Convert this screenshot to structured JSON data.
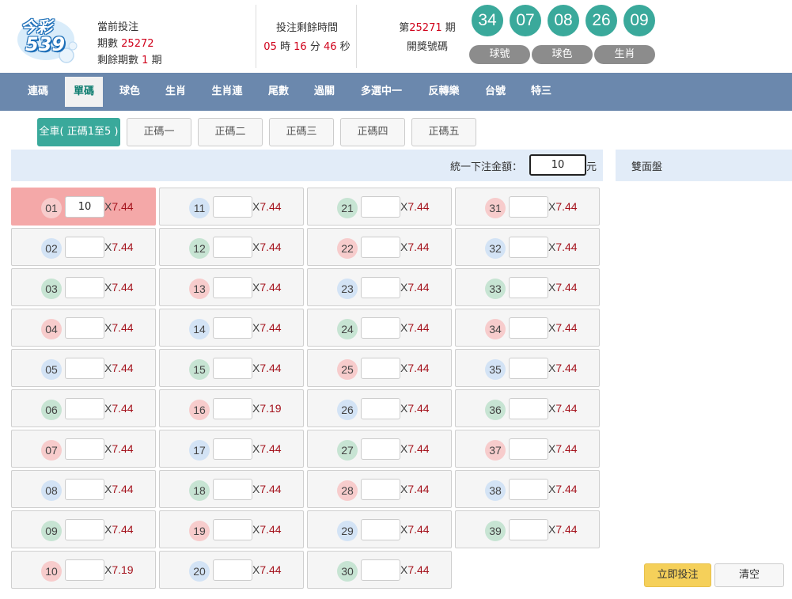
{
  "header": {
    "logo": {
      "line1": "今彩",
      "line2": "539"
    },
    "current_bet_label": "當前投注",
    "period_label": "期數",
    "period_value": "25272",
    "remaining_label": "剩餘期數",
    "remaining_value": "1",
    "remaining_unit": "期",
    "timer_title": "投注剩餘時間",
    "timer": {
      "hours": "05",
      "h_unit": "時",
      "minutes": "16",
      "m_unit": "分",
      "seconds": "46",
      "s_unit": "秒"
    },
    "draw_prefix": "第",
    "draw_period": "25271",
    "draw_suffix": "期",
    "draw_label": "開獎號碼",
    "draw_numbers": [
      "34",
      "07",
      "08",
      "26",
      "09"
    ],
    "view_buttons": [
      "球號",
      "球色",
      "生肖"
    ]
  },
  "nav": {
    "items": [
      "連碼",
      "單碼",
      "球色",
      "生肖",
      "生肖連",
      "尾數",
      "過關",
      "多選中一",
      "反轉樂",
      "台號",
      "特三"
    ],
    "active_index": 1
  },
  "subtabs": {
    "items": [
      "全車( 正碼1至5 )",
      "正碼一",
      "正碼二",
      "正碼三",
      "正碼四",
      "正碼五"
    ],
    "active_index": 0
  },
  "unified": {
    "label": "統一下注金額：",
    "value": "10",
    "unit": "元"
  },
  "side_panel": {
    "label": "雙面盤"
  },
  "grid": {
    "multiply": "X",
    "cells": [
      {
        "num": "01",
        "odds": "7.44",
        "amount": "10",
        "color": "red",
        "selected": true
      },
      {
        "num": "02",
        "odds": "7.44",
        "amount": "",
        "color": "blue"
      },
      {
        "num": "03",
        "odds": "7.44",
        "amount": "",
        "color": "green"
      },
      {
        "num": "04",
        "odds": "7.44",
        "amount": "",
        "color": "red"
      },
      {
        "num": "05",
        "odds": "7.44",
        "amount": "",
        "color": "blue"
      },
      {
        "num": "06",
        "odds": "7.44",
        "amount": "",
        "color": "green"
      },
      {
        "num": "07",
        "odds": "7.44",
        "amount": "",
        "color": "red"
      },
      {
        "num": "08",
        "odds": "7.44",
        "amount": "",
        "color": "blue"
      },
      {
        "num": "09",
        "odds": "7.44",
        "amount": "",
        "color": "green"
      },
      {
        "num": "10",
        "odds": "7.19",
        "amount": "",
        "color": "red"
      },
      {
        "num": "11",
        "odds": "7.44",
        "amount": "",
        "color": "blue"
      },
      {
        "num": "12",
        "odds": "7.44",
        "amount": "",
        "color": "green"
      },
      {
        "num": "13",
        "odds": "7.44",
        "amount": "",
        "color": "red"
      },
      {
        "num": "14",
        "odds": "7.44",
        "amount": "",
        "color": "blue"
      },
      {
        "num": "15",
        "odds": "7.44",
        "amount": "",
        "color": "green"
      },
      {
        "num": "16",
        "odds": "7.19",
        "amount": "",
        "color": "red"
      },
      {
        "num": "17",
        "odds": "7.44",
        "amount": "",
        "color": "blue"
      },
      {
        "num": "18",
        "odds": "7.44",
        "amount": "",
        "color": "green"
      },
      {
        "num": "19",
        "odds": "7.44",
        "amount": "",
        "color": "red"
      },
      {
        "num": "20",
        "odds": "7.44",
        "amount": "",
        "color": "blue"
      },
      {
        "num": "21",
        "odds": "7.44",
        "amount": "",
        "color": "green"
      },
      {
        "num": "22",
        "odds": "7.44",
        "amount": "",
        "color": "red"
      },
      {
        "num": "23",
        "odds": "7.44",
        "amount": "",
        "color": "blue"
      },
      {
        "num": "24",
        "odds": "7.44",
        "amount": "",
        "color": "green"
      },
      {
        "num": "25",
        "odds": "7.44",
        "amount": "",
        "color": "red"
      },
      {
        "num": "26",
        "odds": "7.44",
        "amount": "",
        "color": "blue"
      },
      {
        "num": "27",
        "odds": "7.44",
        "amount": "",
        "color": "green"
      },
      {
        "num": "28",
        "odds": "7.44",
        "amount": "",
        "color": "red"
      },
      {
        "num": "29",
        "odds": "7.44",
        "amount": "",
        "color": "blue"
      },
      {
        "num": "30",
        "odds": "7.44",
        "amount": "",
        "color": "green"
      },
      {
        "num": "31",
        "odds": "7.44",
        "amount": "",
        "color": "red"
      },
      {
        "num": "32",
        "odds": "7.44",
        "amount": "",
        "color": "blue"
      },
      {
        "num": "33",
        "odds": "7.44",
        "amount": "",
        "color": "green"
      },
      {
        "num": "34",
        "odds": "7.44",
        "amount": "",
        "color": "red"
      },
      {
        "num": "35",
        "odds": "7.44",
        "amount": "",
        "color": "blue"
      },
      {
        "num": "36",
        "odds": "7.44",
        "amount": "",
        "color": "green"
      },
      {
        "num": "37",
        "odds": "7.44",
        "amount": "",
        "color": "red"
      },
      {
        "num": "38",
        "odds": "7.44",
        "amount": "",
        "color": "blue"
      },
      {
        "num": "39",
        "odds": "7.44",
        "amount": "",
        "color": "green"
      }
    ]
  },
  "actions": {
    "bet_label": "立即投注",
    "clear_label": "清空"
  },
  "colors": {
    "accent": "#3aa99b",
    "nav": "#6b88ad",
    "odds": "#a4121c",
    "selected": "#f4a8a8"
  }
}
